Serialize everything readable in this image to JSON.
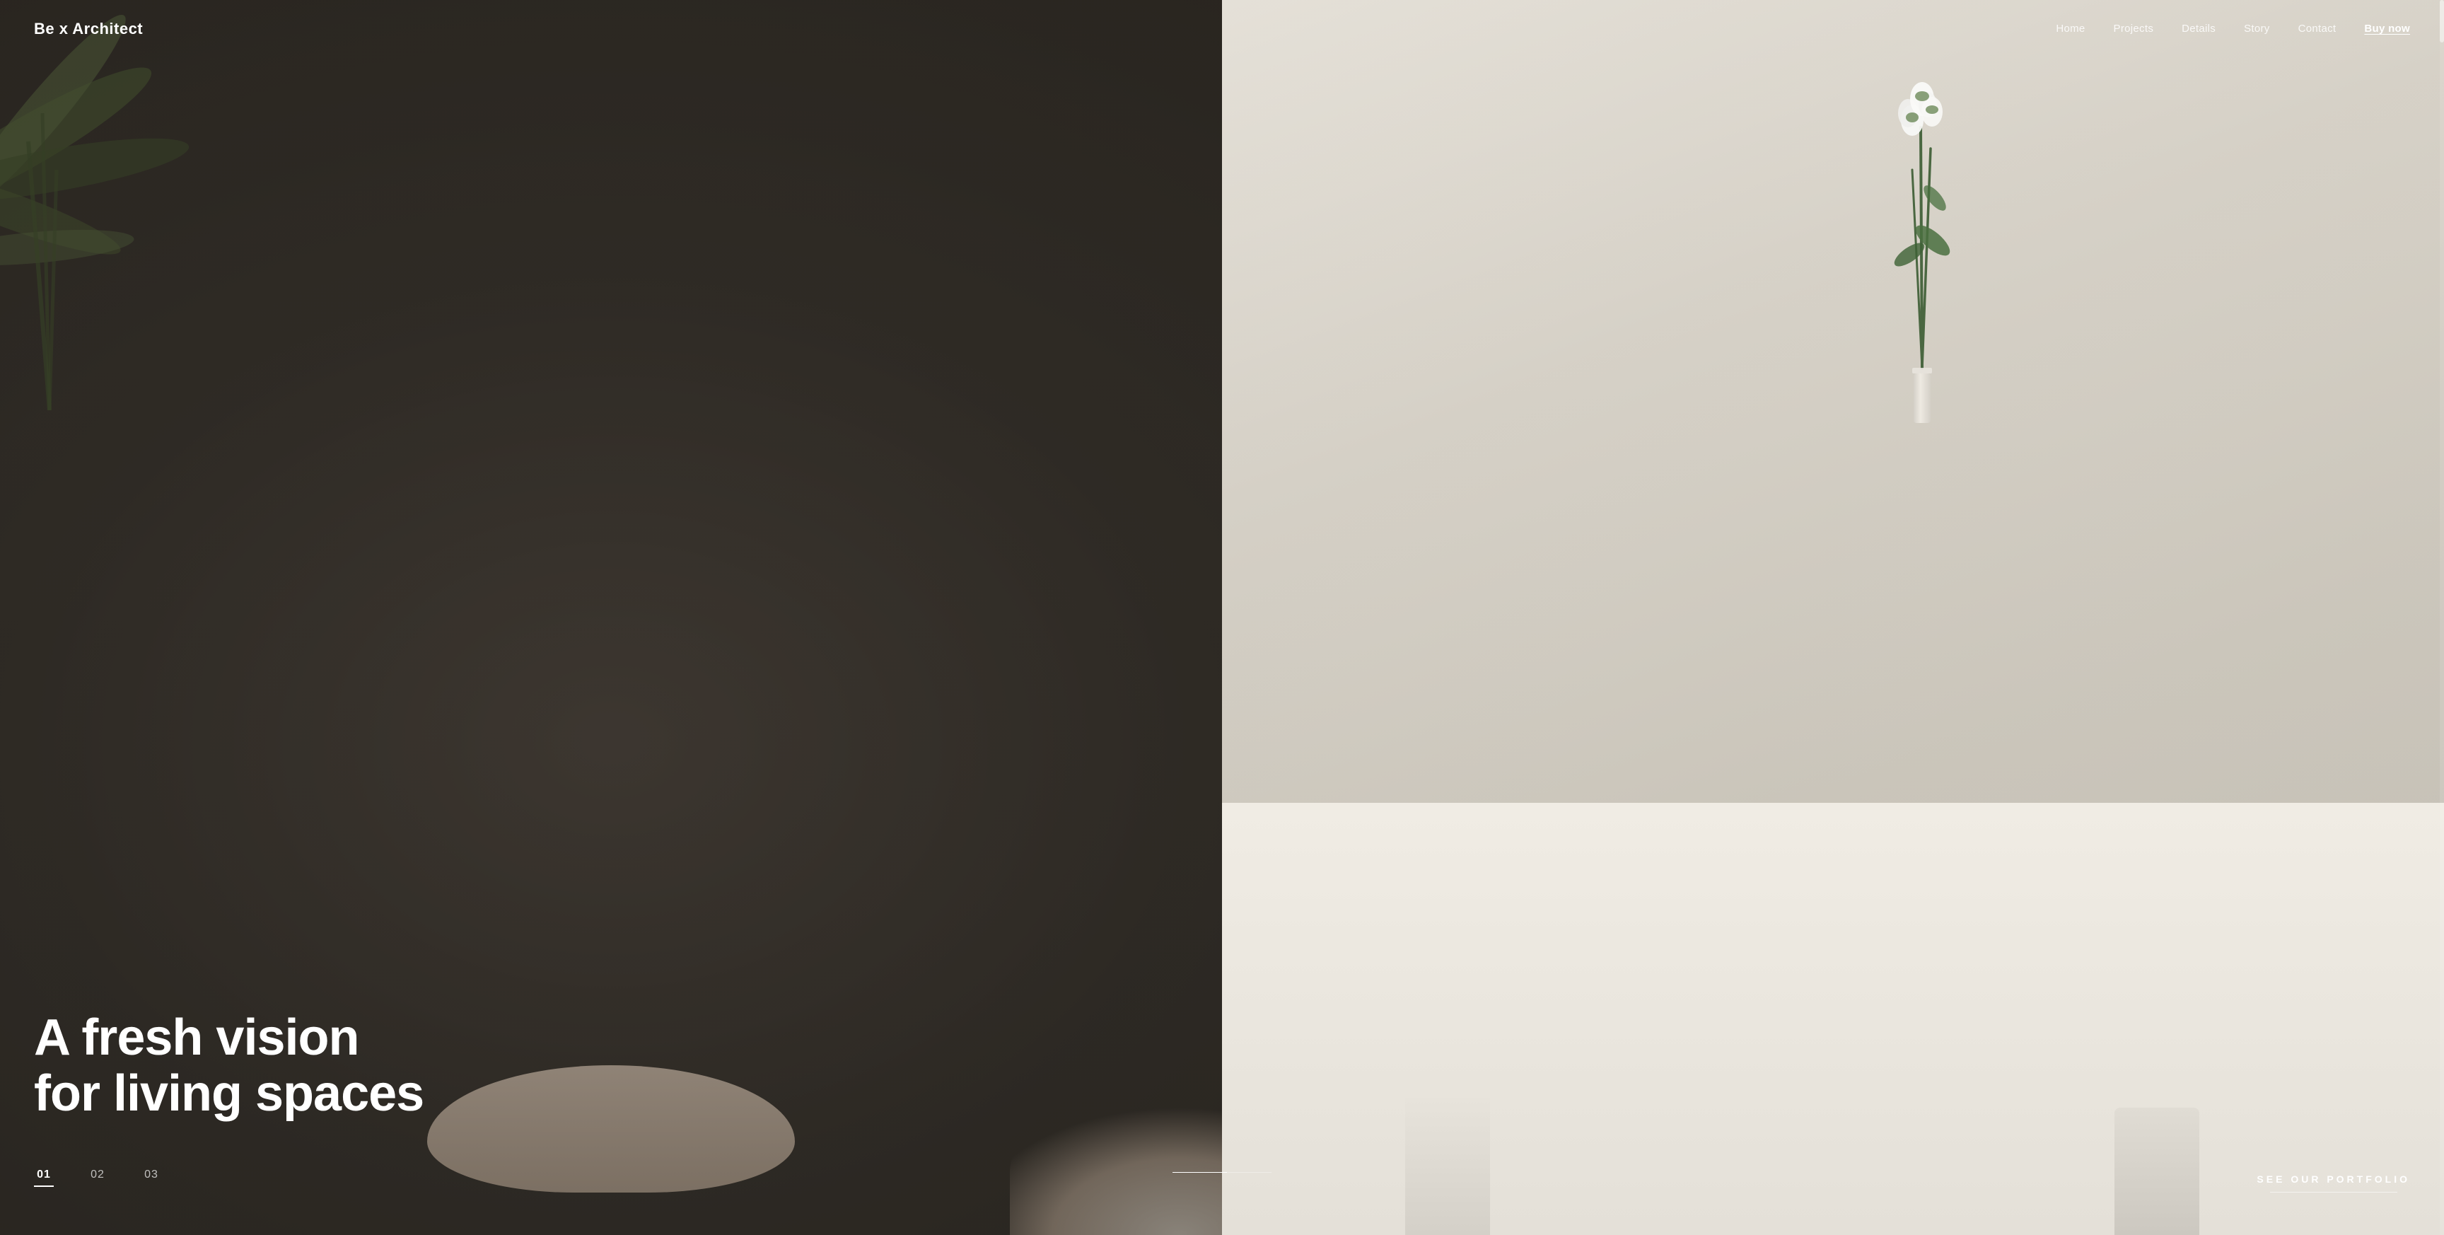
{
  "brand": {
    "logo": "Be x Architect"
  },
  "nav": {
    "items": [
      {
        "label": "Home",
        "active": false
      },
      {
        "label": "Projects",
        "active": false
      },
      {
        "label": "Details",
        "active": false
      },
      {
        "label": "Story",
        "active": false
      },
      {
        "label": "Contact",
        "active": false
      },
      {
        "label": "Buy now",
        "active": true,
        "style": "buy-now"
      }
    ]
  },
  "hero": {
    "headline_line1": "A fresh vision",
    "headline_line2": "for living spaces"
  },
  "slides": [
    {
      "num": "01",
      "active": true
    },
    {
      "num": "02",
      "active": false
    },
    {
      "num": "03",
      "active": false
    }
  ],
  "progress": {
    "fill_percent": 55
  },
  "cta": {
    "label": "SEE OUR PORTFOLIO"
  }
}
